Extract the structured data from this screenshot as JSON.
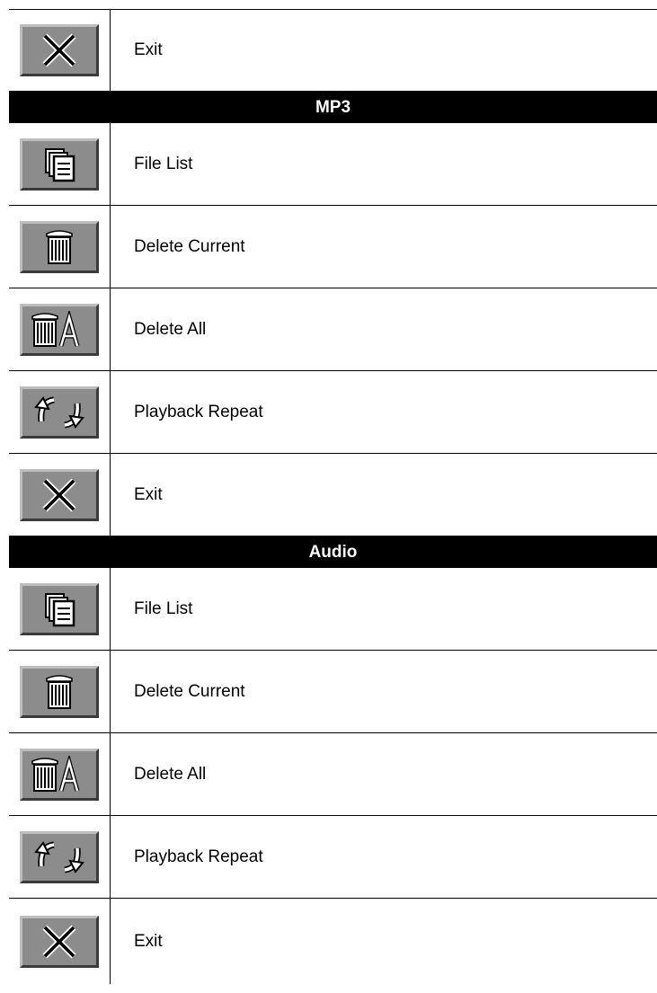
{
  "sections": [
    {
      "rows": [
        {
          "icon": "exit-icon",
          "label": "Exit"
        }
      ]
    },
    {
      "header": "MP3",
      "rows": [
        {
          "icon": "file-list-icon",
          "label": "File List"
        },
        {
          "icon": "delete-current-icon",
          "label": "Delete Current"
        },
        {
          "icon": "delete-all-icon",
          "label": "Delete All"
        },
        {
          "icon": "playback-repeat-icon",
          "label": "Playback Repeat"
        },
        {
          "icon": "exit-icon",
          "label": "Exit"
        }
      ]
    },
    {
      "header": "Audio",
      "rows": [
        {
          "icon": "file-list-icon",
          "label": "File List"
        },
        {
          "icon": "delete-current-icon",
          "label": "Delete Current"
        },
        {
          "icon": "delete-all-icon",
          "label": "Delete All"
        },
        {
          "icon": "playback-repeat-icon",
          "label": "Playback Repeat"
        },
        {
          "icon": "exit-icon",
          "label": "Exit"
        }
      ]
    }
  ],
  "colors": {
    "button_face": "#8c8c8c",
    "header_bg": "#000000",
    "header_text": "#ffffff"
  }
}
